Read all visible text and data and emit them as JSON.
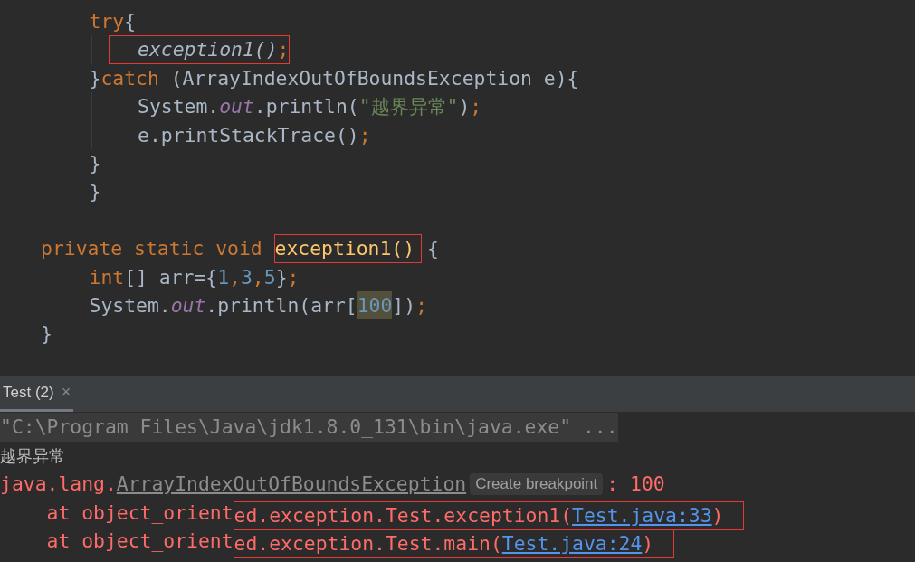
{
  "editor": {
    "lines": [
      {
        "children": [
          {
            "tokens": [
              {
                "text": "try",
                "kind": "keyword"
              },
              {
                "text": "{",
                "kind": "plain"
              }
            ]
          },
          {
            "children": [
              {
                "tokens": [
                  {
                    "kind": "annotation",
                    "tokens": [
                      {
                        "text": "exception1()",
                        "kind": "call"
                      },
                      {
                        "text": ";",
                        "kind": "punct"
                      }
                    ]
                  }
                ]
              }
            ]
          },
          {
            "tokens": [
              {
                "text": "}",
                "kind": "plain"
              },
              {
                "text": "catch",
                "kind": "keyword"
              },
              {
                "text": " (ArrayIndexOutOfBoundsException e){",
                "kind": "plain"
              }
            ]
          },
          {
            "children": [
              {
                "tokens": [
                  {
                    "text": "System.",
                    "kind": "plain"
                  },
                  {
                    "text": "out",
                    "kind": "field"
                  },
                  {
                    "text": ".println(",
                    "kind": "plain"
                  },
                  {
                    "text": "\"越界异常\"",
                    "kind": "string"
                  },
                  {
                    "text": ")",
                    "kind": "plain"
                  },
                  {
                    "text": ";",
                    "kind": "punct"
                  }
                ]
              },
              {
                "tokens": [
                  {
                    "text": "e.printStackTrace()",
                    "kind": "plain"
                  },
                  {
                    "text": ";",
                    "kind": "punct"
                  }
                ]
              }
            ]
          },
          {
            "tokens": [
              {
                "text": "}",
                "kind": "plain"
              }
            ]
          },
          {
            "tokens": [
              {
                "text": "}",
                "kind": "plain"
              }
            ]
          }
        ]
      },
      {
        "gap_before": true,
        "tokens": [
          {
            "text": "private static void ",
            "kind": "keyword"
          },
          {
            "kind": "annotation",
            "tokens": [
              {
                "text": "exception1()",
                "kind": "decl"
              }
            ]
          },
          {
            "text": " {",
            "kind": "plain"
          }
        ]
      },
      {
        "children": [
          {
            "tokens": [
              {
                "text": "int",
                "kind": "keyword"
              },
              {
                "text": "[] arr={",
                "kind": "plain"
              },
              {
                "text": "1",
                "kind": "number"
              },
              {
                "text": ",",
                "kind": "punct"
              },
              {
                "text": "3",
                "kind": "number"
              },
              {
                "text": ",",
                "kind": "punct"
              },
              {
                "text": "5",
                "kind": "number"
              },
              {
                "text": "}",
                "kind": "plain"
              },
              {
                "text": ";",
                "kind": "punct"
              }
            ]
          },
          {
            "tokens": [
              {
                "text": "System.",
                "kind": "plain"
              },
              {
                "text": "out",
                "kind": "field"
              },
              {
                "text": ".println(arr[",
                "kind": "plain"
              },
              {
                "text": "100",
                "kind": "number-highlight"
              },
              {
                "text": "])",
                "kind": "plain"
              },
              {
                "text": ";",
                "kind": "punct"
              }
            ]
          }
        ]
      },
      {
        "tokens": [
          {
            "text": "}",
            "kind": "plain"
          }
        ]
      }
    ]
  },
  "run_panel": {
    "tabs": [
      {
        "label": "Test (2)",
        "close": "×",
        "selected": true
      }
    ],
    "lines": [
      [
        {
          "text": "\"C:\\Program Files\\Java\\jdk1.8.0_131\\bin\\java.exe\" ...",
          "kind": "command"
        }
      ],
      [
        {
          "text": "越界异常",
          "kind": "output"
        }
      ],
      [
        {
          "text": "java.lang.",
          "kind": "error"
        },
        {
          "text": "ArrayIndexOutOfBoundsException",
          "kind": "error-class"
        },
        {
          "text": "Create breakpoint",
          "kind": "hint"
        },
        {
          "text": ": 100",
          "kind": "error"
        }
      ],
      [
        {
          "text": "at object_orient",
          "kind": "error-indented"
        },
        {
          "kind": "annotation",
          "segments": [
            {
              "text": "ed.exception.Test.exception1(",
              "kind": "error"
            },
            {
              "text": "Test.java:33",
              "kind": "link"
            },
            {
              "text": ")",
              "kind": "error"
            }
          ]
        }
      ],
      [
        {
          "text": "at object_orient",
          "kind": "error-indented"
        },
        {
          "kind": "annotation",
          "segments": [
            {
              "text": "ed.exception.Test.main(",
              "kind": "error"
            },
            {
              "text": "Test.java:24",
              "kind": "link"
            },
            {
              "text": ")",
              "kind": "error"
            }
          ]
        }
      ]
    ]
  }
}
